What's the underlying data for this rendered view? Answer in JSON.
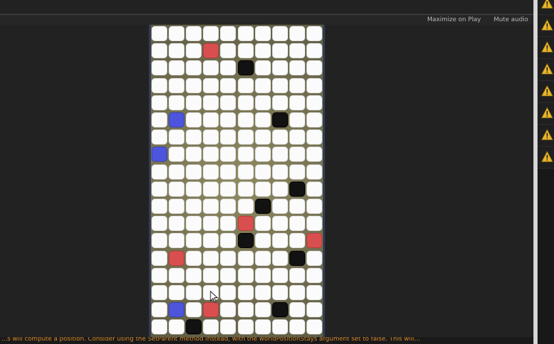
{
  "toolbar": {
    "maximize_label": "Maximize on Play",
    "mute_label": "Mute audio"
  },
  "board": {
    "columns": 10,
    "rows": 18,
    "cells": [
      "..........",
      "...R......",
      ".....K....",
      "..........",
      "..........",
      ".B.....K..",
      "..........",
      "B.........",
      "..........",
      "........K.",
      "......K...",
      ".....R....",
      ".....K...R",
      ".R......K.",
      "..........",
      "..........",
      ".B.R...K..",
      "..K......."
    ],
    "colors": {
      ".": "#fbfbfb",
      "R": "#d94f4f",
      "B": "#4c55dc",
      "K": "#121212"
    }
  },
  "console": {
    "message": "...s will compute a position. Consider using the SetParent method instead, with the worldPositionStays argument set to false. This will..."
  },
  "warnings": {
    "count": 8,
    "icon": "warning-icon",
    "color": "#e8b62a"
  }
}
